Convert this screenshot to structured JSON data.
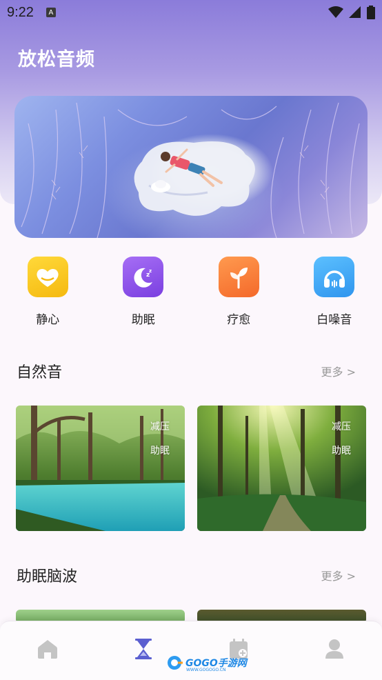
{
  "status_bar": {
    "time": "9:22",
    "notification_letter": "A",
    "wifi_icon": "wifi-icon",
    "signal_icon": "signal-icon",
    "battery_icon": "battery-icon"
  },
  "page": {
    "title": "放松音频"
  },
  "banner": {
    "image": "person-lying-on-cloud-in-grass-illustration"
  },
  "quick_categories": [
    {
      "label": "静心",
      "icon": "heart-icon",
      "color": "#f7c31b"
    },
    {
      "label": "助眠",
      "icon": "moon-icon",
      "color": "#8c53ea"
    },
    {
      "label": "疗愈",
      "icon": "sprout-icon",
      "color": "#ff7a3c"
    },
    {
      "label": "白噪音",
      "icon": "headphones-icon",
      "color": "#3aa8f5"
    }
  ],
  "sections": [
    {
      "title": "自然音",
      "more_label": "更多 >",
      "cards": [
        {
          "image": "forest-lake",
          "tags": [
            "减压",
            "助眠"
          ]
        },
        {
          "image": "sunlit-forest-path",
          "tags": [
            "减压",
            "助眠"
          ]
        }
      ]
    },
    {
      "title": "助眠脑波",
      "more_label": "更多 >"
    }
  ],
  "bottom_nav": [
    {
      "name": "home",
      "icon": "home-icon",
      "active": false
    },
    {
      "name": "timer",
      "icon": "hourglass-icon",
      "active": true
    },
    {
      "name": "calendar",
      "icon": "calendar-icon",
      "active": false
    },
    {
      "name": "profile",
      "icon": "profile-icon",
      "active": false
    }
  ],
  "watermark": {
    "text": "GOGO手游网",
    "url_text": "WWW.GOGOGO.CN"
  },
  "colors": {
    "accent": "#5b5fd0",
    "header": "#8b7cda",
    "nav_inactive": "#bfbfbf"
  }
}
